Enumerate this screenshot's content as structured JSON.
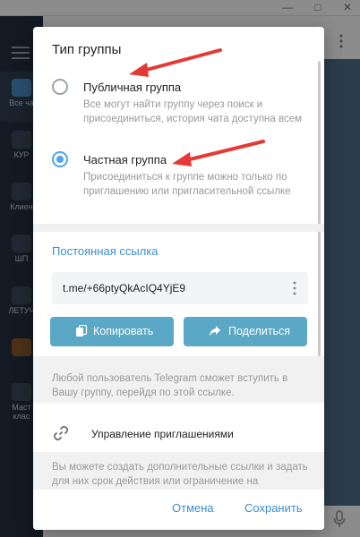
{
  "background": {
    "sidebar": {
      "items": [
        {
          "label": "Все ча",
          "icon": "chat-bubbles-icon"
        },
        {
          "label": "КУР",
          "icon": "folder-icon"
        },
        {
          "label": "Клиен",
          "icon": "crown-icon"
        },
        {
          "label": "ШП",
          "icon": "folder-icon"
        },
        {
          "label": "ЛЕТУЧ",
          "icon": "folder-icon"
        },
        {
          "label": "",
          "icon": "emoji-folder-icon"
        },
        {
          "label": "Маст",
          "icon": "star-icon"
        },
        {
          "label": "клас",
          "icon": "folder-icon"
        }
      ]
    }
  },
  "dialog": {
    "title": "Тип группы",
    "options": [
      {
        "label": "Публичная группа",
        "description": "Все могут найти группу через поиск и присоединиться, история чата доступна всем",
        "selected": false
      },
      {
        "label": "Частная группа",
        "description": "Присоединиться к группе можно только по приглашению или пригласительной ссылке",
        "selected": true
      }
    ],
    "permanent_link": {
      "title": "Постоянная ссылка",
      "url": "t.me/+66ptyQkAcIQ4YjE9",
      "copy_label": "Копировать",
      "share_label": "Поделиться",
      "note": "Любой пользователь Telegram сможет вступить в Вашу группу, перейдя по этой ссылке."
    },
    "manage_invites": {
      "label": "Управление приглашениями",
      "note": "Вы можете создать дополнительные ссылки и задать для них срок действия или ограничение на"
    },
    "footer": {
      "cancel_label": "Отмена",
      "save_label": "Сохранить"
    }
  },
  "colors": {
    "accent": "#3a8dd5",
    "radio_selected": "#4ea4f6",
    "button_bg": "#5aa7c6",
    "annotation_arrow": "#e53935",
    "sidebar_bg": "#233040"
  }
}
